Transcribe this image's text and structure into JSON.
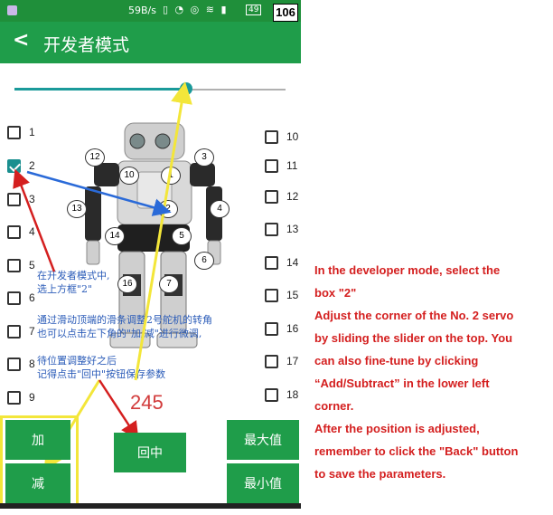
{
  "status_bar": {
    "speed": "59B/s",
    "battery": "49",
    "time": "1",
    "badge_number": "106"
  },
  "toolbar": {
    "back_icon": "chevron-left-icon",
    "title": "开发者模式"
  },
  "slider": {
    "value_fraction": 0.63
  },
  "checkboxes_left": [
    {
      "label": "1",
      "checked": false
    },
    {
      "label": "2",
      "checked": true
    },
    {
      "label": "3",
      "checked": false
    },
    {
      "label": "4",
      "checked": false
    },
    {
      "label": "5",
      "checked": false
    },
    {
      "label": "6",
      "checked": false
    },
    {
      "label": "7",
      "checked": false
    },
    {
      "label": "8",
      "checked": false
    },
    {
      "label": "9",
      "checked": false
    }
  ],
  "checkboxes_right": [
    {
      "label": "10",
      "checked": false
    },
    {
      "label": "11",
      "checked": false
    },
    {
      "label": "12",
      "checked": false
    },
    {
      "label": "13",
      "checked": false
    },
    {
      "label": "14",
      "checked": false
    },
    {
      "label": "15",
      "checked": false
    },
    {
      "label": "16",
      "checked": false
    },
    {
      "label": "17",
      "checked": false
    },
    {
      "label": "18",
      "checked": false
    }
  ],
  "servo_labels": [
    "12",
    "3",
    "10",
    "1",
    "13",
    "2",
    "4",
    "14",
    "5",
    "6",
    "16",
    "7"
  ],
  "servo_value": "245",
  "buttons": {
    "add": "加",
    "subtract": "减",
    "back_middle": "回中",
    "max": "最大值",
    "min": "最小值"
  },
  "callouts": {
    "step1_line1": "在开发者模式中,",
    "step1_line2": "选上方框\"2\"",
    "step2_line1": "通过滑动顶端的滑条调整2号舵机的转角",
    "step2_line2": "也可以点击左下角的\"加/减\"进行微调,",
    "step3_line1": "待位置调整好之后",
    "step3_line2": "记得点击\"回中\"按钮保存参数"
  },
  "annotation": [
    "In the developer mode, select the",
    "box \"2\"",
    "Adjust the corner of the No. 2 servo",
    "by sliding the slider on the top. You",
    "can also fine-tune by clicking",
    "“Add/Subtract”  in the lower left",
    "corner.",
    "After the position is adjusted,",
    "remember to click the \"Back\" button",
    "to save the parameters."
  ],
  "colors": {
    "toolbar": "#1f9d4a",
    "button": "#1f9d4a",
    "accent": "#1a9a9a",
    "annotation_red": "#d41f1f",
    "highlight_yellow": "#f3e63a"
  }
}
